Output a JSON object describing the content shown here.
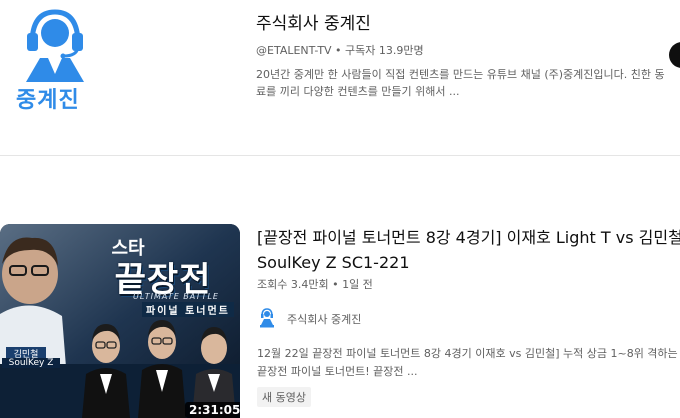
{
  "channel": {
    "logo_text": "중계진",
    "name": "주식회사 중계진",
    "meta": "@ETALENT-TV • 구독자 13.9만명",
    "description": "20년간 중계만 한 사람들이 직접 컨텐츠를 만드는 유튜브 채널 (주)중계진입니다. 친한 동료를 끼리 다양한 컨텐츠를 만들기 위해서 ...",
    "brand_color": "#2f8be8"
  },
  "video": {
    "title": "[끝장전 파이널 토너먼트 8강 4경기] 이재호 Light T vs 김민철 SoulKey Z SC1-221",
    "meta": "조회수 3.4만회 • 1일 전",
    "channel_name": "주식회사 중계진",
    "description": "12월 22일 끝장전 파이널 토너먼트 8강 4경기 이재호 vs 김민철] 누적 상금 1~8위 격하는 끝장전 파이널 토너먼트! 끝장전 ...",
    "badge": "새 동영상",
    "duration": "2:31:05",
    "thumbnail": {
      "small_title": "스타",
      "big_title": "끝장전",
      "sub_title": "ULTIMATE BATTLE",
      "tournament": "파이널 토너먼트",
      "player_name": "김민철",
      "player_id": "SoulKey Z"
    }
  }
}
